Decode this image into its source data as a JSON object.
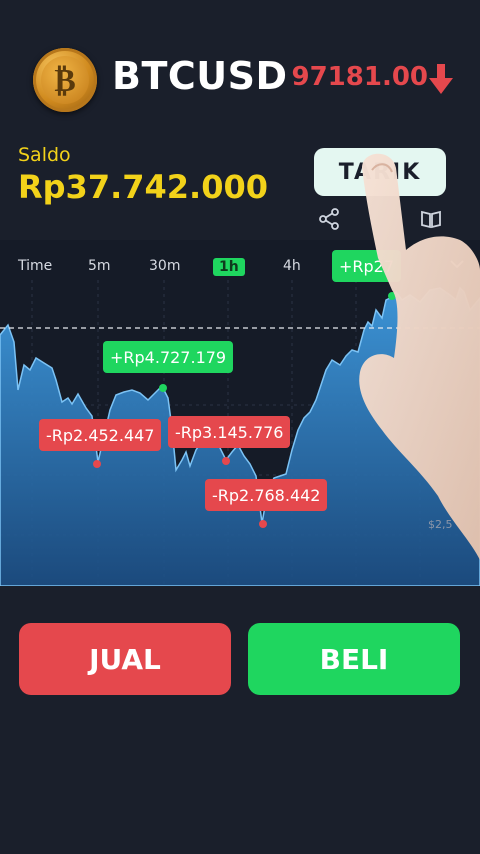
{
  "header": {
    "coin_symbol": "₿",
    "pair": "BTCUSD",
    "price": "97181.00",
    "price_direction": "down",
    "price_color": "#e5484d"
  },
  "balance": {
    "label": "Saldo",
    "value": "Rp37.742.000",
    "color": "#f2d21a"
  },
  "actions": {
    "withdraw_label": "TARIK",
    "share_icon": "share-icon",
    "book_icon": "book-icon"
  },
  "chart": {
    "timeframes": [
      "Time",
      "5m",
      "30m",
      "1h",
      "4h"
    ],
    "active_timeframe": "1h",
    "tags": [
      {
        "text": "+Rp4.727.179",
        "kind": "profit"
      },
      {
        "text": "-Rp2.452.447",
        "kind": "loss"
      },
      {
        "text": "-Rp3.145.776",
        "kind": "loss"
      },
      {
        "text": "-Rp2.768.442",
        "kind": "loss"
      },
      {
        "text": "+Rp27",
        "kind": "profit"
      }
    ],
    "scale_label": "$2,5"
  },
  "trade": {
    "sell_label": "JUAL",
    "buy_label": "BELI",
    "sell_color": "#e5484d",
    "buy_color": "#1fd65f"
  }
}
